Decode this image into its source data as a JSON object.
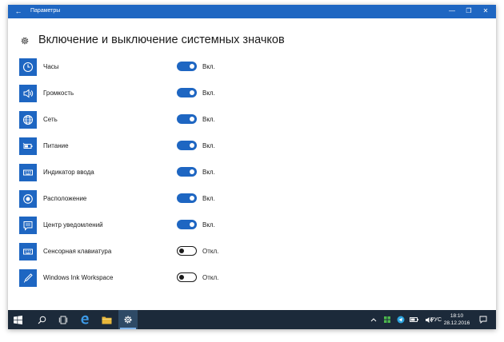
{
  "window": {
    "title": "Параметры",
    "back_glyph": "←",
    "minimize_glyph": "—",
    "maximize_glyph": "❐",
    "close_glyph": "✕"
  },
  "page": {
    "title": "Включение и выключение системных значков",
    "icon": "gear-icon"
  },
  "items": [
    {
      "label": "Часы",
      "icon": "clock-icon",
      "on": true,
      "state": "Вкл."
    },
    {
      "label": "Громкость",
      "icon": "volume-icon",
      "on": true,
      "state": "Вкл."
    },
    {
      "label": "Сеть",
      "icon": "globe-icon",
      "on": true,
      "state": "Вкл."
    },
    {
      "label": "Питание",
      "icon": "battery-icon",
      "on": true,
      "state": "Вкл."
    },
    {
      "label": "Индикатор ввода",
      "icon": "keyboard-icon",
      "on": true,
      "state": "Вкл."
    },
    {
      "label": "Расположение",
      "icon": "location-icon",
      "on": true,
      "state": "Вкл."
    },
    {
      "label": "Центр уведомлений",
      "icon": "notification-icon",
      "on": true,
      "state": "Вкл."
    },
    {
      "label": "Сенсорная клавиатура",
      "icon": "touch-keyboard-icon",
      "on": false,
      "state": "Откл."
    },
    {
      "label": "Windows Ink Workspace",
      "icon": "pen-icon",
      "on": false,
      "state": "Откл."
    }
  ],
  "taskbar": {
    "items": [
      "windows-start-icon",
      "search-icon",
      "task-view-icon",
      "edge-icon",
      "file-explorer-icon",
      "settings-icon"
    ],
    "active": "settings-icon",
    "language": "РУС",
    "time": "18:10",
    "date": "28.12.2016"
  },
  "colors": {
    "accent": "#1e66c2",
    "taskbar": "#1c2a3a"
  }
}
